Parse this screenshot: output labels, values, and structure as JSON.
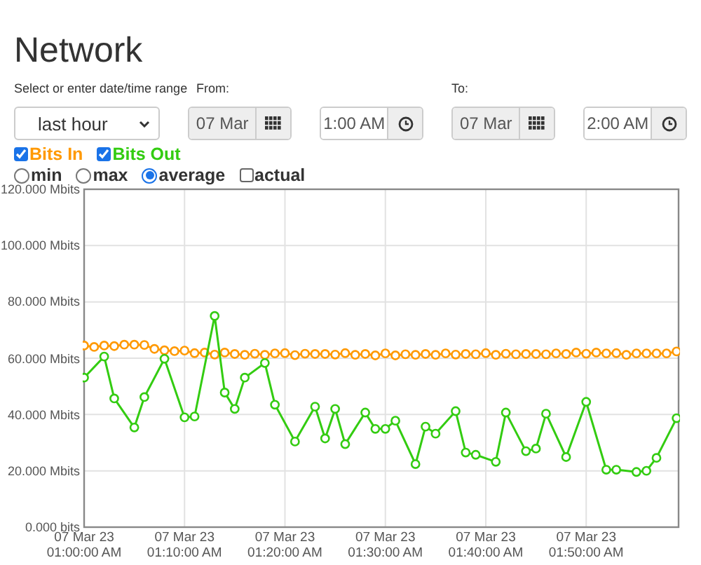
{
  "title": "Network",
  "range": {
    "label": "Select or enter date/time range",
    "value": "last hour"
  },
  "from": {
    "label": "From:",
    "date": "07 Mar",
    "time": "1:00 AM"
  },
  "to": {
    "label": "To:",
    "date": "07 Mar",
    "time": "2:00 AM"
  },
  "series_toggles": [
    {
      "checked": true
    },
    {
      "checked": true
    }
  ],
  "modes": [
    {
      "kind": "radio",
      "label": "min",
      "selected": false
    },
    {
      "kind": "radio",
      "label": "max",
      "selected": false
    },
    {
      "kind": "radio",
      "label": "average",
      "selected": true
    },
    {
      "kind": "checkbox",
      "label": "actual",
      "checked": false
    }
  ],
  "chart": {
    "chart_data": {
      "type": "line",
      "grid": true,
      "ylim": [
        0,
        120
      ],
      "yticks": [
        {
          "value": 0,
          "label": "0.000 bits"
        },
        {
          "value": 20,
          "label": "20.000 Mbits"
        },
        {
          "value": 40,
          "label": "40.000 Mbits"
        },
        {
          "value": 60,
          "label": "60.000 Mbits"
        },
        {
          "value": 80,
          "label": "80.000 Mbits"
        },
        {
          "value": 100,
          "label": "100.000 Mbits"
        },
        {
          "value": 120,
          "label": "120.000 Mbits"
        }
      ],
      "categories": [
        "07 Mar 23 01:00:00 AM",
        null,
        null,
        null,
        null,
        null,
        null,
        null,
        null,
        null,
        "07 Mar 23 01:10:00 AM",
        null,
        null,
        null,
        null,
        null,
        null,
        null,
        null,
        null,
        "07 Mar 23 01:20:00 AM",
        null,
        null,
        null,
        null,
        null,
        null,
        null,
        null,
        null,
        "07 Mar 23 01:30:00 AM",
        null,
        null,
        null,
        null,
        null,
        null,
        null,
        null,
        null,
        "07 Mar 23 01:40:00 AM",
        null,
        null,
        null,
        null,
        null,
        null,
        null,
        null,
        null,
        "07 Mar 23 01:50:00 AM",
        null,
        null,
        null,
        null,
        null,
        null,
        null,
        null,
        null
      ],
      "series": [
        {
          "name": "Bits In",
          "color": "#ff9900",
          "marker": "circle",
          "values": [
            64.5,
            64,
            64.5,
            64.3,
            64.8,
            64.8,
            64.7,
            63.3,
            62.8,
            62.5,
            62.7,
            61.8,
            62,
            61.3,
            62,
            61.5,
            61.2,
            61.6,
            61.2,
            61.7,
            61.8,
            61.1,
            61.6,
            61.5,
            61.5,
            61.3,
            61.8,
            61.2,
            61.5,
            61,
            61.7,
            61,
            61.4,
            61.2,
            61.5,
            61.2,
            61.7,
            61.3,
            61.5,
            61.4,
            61.8,
            61.2,
            61.6,
            61.4,
            61.5,
            61.5,
            61.4,
            61.7,
            61.5,
            62,
            61.6,
            62,
            61.7,
            61.8,
            61.2,
            61.7,
            61.7,
            61.7,
            61.7,
            62.4
          ]
        },
        {
          "name": "Bits Out",
          "color": "#33cc11",
          "marker": "circle",
          "values": [
            53.1,
            null,
            60.6,
            45.7,
            null,
            35.4,
            46.2,
            null,
            59.8,
            null,
            39,
            39.3,
            null,
            75,
            47.8,
            42,
            53.1,
            null,
            58.3,
            43.5,
            null,
            30.4,
            null,
            42.8,
            31.5,
            42,
            29.5,
            null,
            40.7,
            34.9,
            34.9,
            37.8,
            null,
            22.4,
            35.7,
            33.2,
            null,
            41.2,
            26.5,
            25.7,
            null,
            23.2,
            40.7,
            null,
            27,
            27.9,
            40.3,
            null,
            24.9,
            null,
            44.5,
            null,
            20.4,
            20.4,
            null,
            19.6,
            20,
            24.6,
            null,
            38.7
          ]
        }
      ]
    }
  }
}
